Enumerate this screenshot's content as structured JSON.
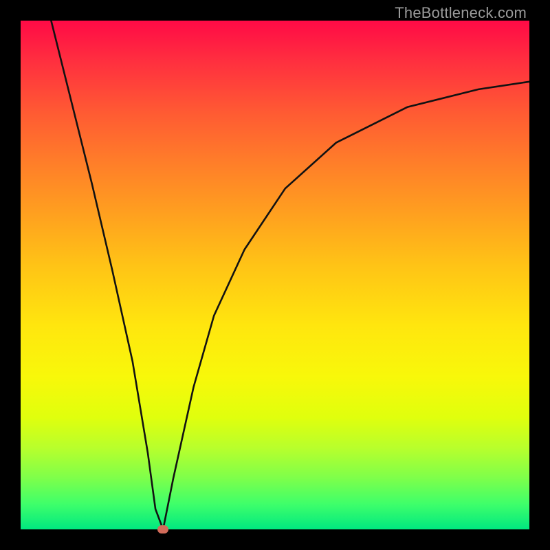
{
  "watermark": "TheBottleneck.com",
  "chart_data": {
    "type": "line",
    "title": "",
    "xlabel": "",
    "ylabel": "",
    "xlim": [
      0,
      100
    ],
    "ylim": [
      0,
      100
    ],
    "grid": false,
    "legend": false,
    "series": [
      {
        "name": "curve",
        "x": [
          6,
          10,
          14,
          18,
          22,
          25,
          26.5,
          28,
          30,
          34,
          38,
          44,
          52,
          62,
          76,
          90,
          100
        ],
        "y": [
          100,
          84,
          68,
          51,
          33,
          15,
          4,
          0,
          10,
          28,
          42,
          55,
          67,
          76,
          83,
          86.5,
          88
        ]
      }
    ],
    "marker": {
      "x": 28,
      "y": 0,
      "color": "#d26b5a"
    },
    "background_gradient": [
      "#ff0a46",
      "#ff5a33",
      "#ffa01f",
      "#ffe60e",
      "#b8ff2c",
      "#00e880"
    ]
  }
}
